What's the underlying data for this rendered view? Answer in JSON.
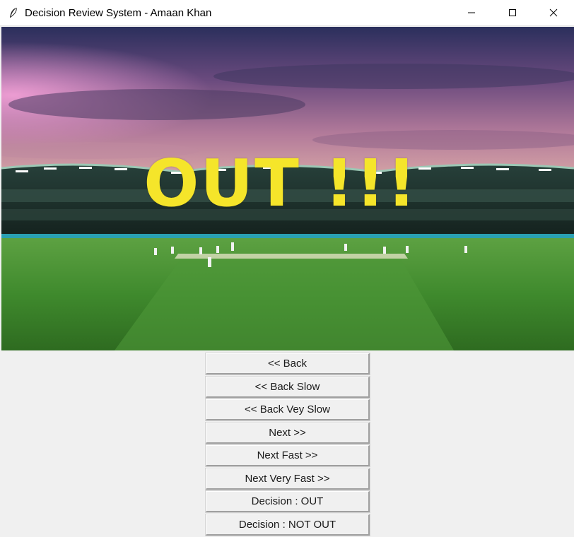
{
  "window": {
    "title": "Decision Review System - Amaan Khan",
    "app_icon": "feather-icon",
    "controls": [
      "minimize-icon",
      "maximize-icon",
      "close-icon"
    ]
  },
  "display": {
    "overlay_text": "OUT !!!",
    "overlay_color": "#f5e52a"
  },
  "buttons": [
    {
      "label": "<< Back"
    },
    {
      "label": "<< Back Slow"
    },
    {
      "label": "<< Back Vey Slow"
    },
    {
      "label": "Next >>"
    },
    {
      "label": "Next Fast >>"
    },
    {
      "label": "Next Very Fast >>"
    },
    {
      "label": "Decision : OUT"
    },
    {
      "label": "Decision : NOT OUT"
    }
  ]
}
